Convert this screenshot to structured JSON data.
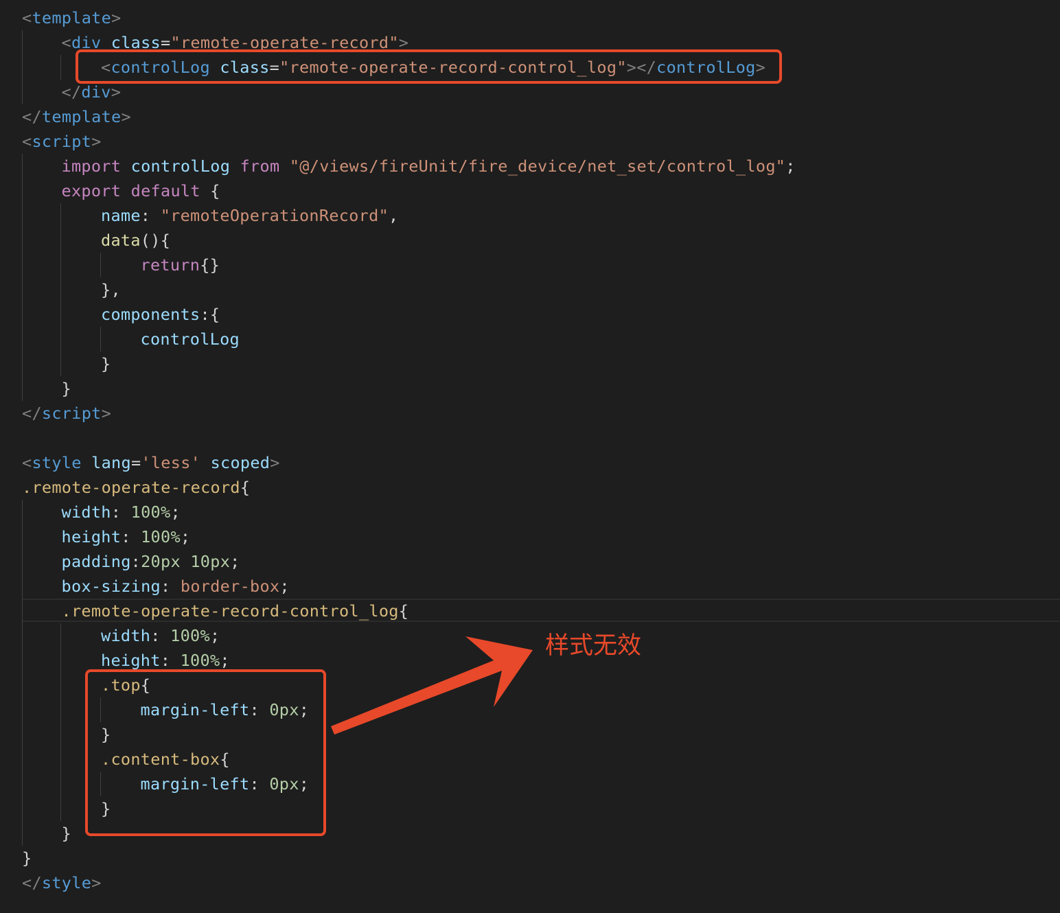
{
  "editor": {
    "colors": {
      "background": "#1e1e1e",
      "annotation": "#e8492a"
    },
    "lines": [
      [
        [
          "punc",
          "<"
        ],
        [
          "tag",
          "template"
        ],
        [
          "punc",
          ">"
        ]
      ],
      [
        [
          "punc",
          "<"
        ],
        [
          "tag",
          "div"
        ],
        [
          "text",
          " "
        ],
        [
          "attr",
          "class"
        ],
        [
          "text",
          "="
        ],
        [
          "str",
          "\"remote-operate-record\""
        ],
        [
          "punc",
          ">"
        ]
      ],
      [
        [
          "punc",
          "<"
        ],
        [
          "tag",
          "controlLog"
        ],
        [
          "text",
          " "
        ],
        [
          "attr",
          "class"
        ],
        [
          "text",
          "="
        ],
        [
          "str",
          "\"remote-operate-record-control_log\""
        ],
        [
          "punc",
          "></"
        ],
        [
          "tag",
          "controlLog"
        ],
        [
          "punc",
          ">"
        ]
      ],
      [
        [
          "punc",
          "</"
        ],
        [
          "tag",
          "div"
        ],
        [
          "punc",
          ">"
        ]
      ],
      [
        [
          "punc",
          "</"
        ],
        [
          "tag",
          "template"
        ],
        [
          "punc",
          ">"
        ]
      ],
      [
        [
          "punc",
          "<"
        ],
        [
          "tag",
          "script"
        ],
        [
          "punc",
          ">"
        ]
      ],
      [
        [
          "kw",
          "import"
        ],
        [
          "text",
          " "
        ],
        [
          "var",
          "controlLog"
        ],
        [
          "text",
          " "
        ],
        [
          "kw",
          "from"
        ],
        [
          "text",
          " "
        ],
        [
          "str",
          "\"@/views/fireUnit/fire_device/net_set/control_log\""
        ],
        [
          "text",
          ";"
        ]
      ],
      [
        [
          "kw",
          "export"
        ],
        [
          "text",
          " "
        ],
        [
          "kw",
          "default"
        ],
        [
          "text",
          " {"
        ]
      ],
      [
        [
          "var",
          "name"
        ],
        [
          "text",
          ": "
        ],
        [
          "str",
          "\"remoteOperationRecord\""
        ],
        [
          "text",
          ","
        ]
      ],
      [
        [
          "func",
          "data"
        ],
        [
          "text",
          "(){"
        ]
      ],
      [
        [
          "kw",
          "return"
        ],
        [
          "text",
          "{}"
        ]
      ],
      [
        [
          "text",
          "},"
        ]
      ],
      [
        [
          "var",
          "components"
        ],
        [
          "text",
          ":{"
        ]
      ],
      [
        [
          "var",
          "controlLog"
        ]
      ],
      [
        [
          "text",
          "}"
        ]
      ],
      [
        [
          "text",
          "}"
        ]
      ],
      [
        [
          "punc",
          "</"
        ],
        [
          "tag",
          "script"
        ],
        [
          "punc",
          ">"
        ]
      ],
      [],
      [
        [
          "punc",
          "<"
        ],
        [
          "tag",
          "style"
        ],
        [
          "text",
          " "
        ],
        [
          "attr",
          "lang"
        ],
        [
          "text",
          "="
        ],
        [
          "str",
          "'less'"
        ],
        [
          "text",
          " "
        ],
        [
          "attr",
          "scoped"
        ],
        [
          "punc",
          ">"
        ]
      ],
      [
        [
          "sel",
          ".remote-operate-record"
        ],
        [
          "text",
          "{"
        ]
      ],
      [
        [
          "prop",
          "width"
        ],
        [
          "text",
          ": "
        ],
        [
          "num",
          "100%"
        ],
        [
          "text",
          ";"
        ]
      ],
      [
        [
          "prop",
          "height"
        ],
        [
          "text",
          ": "
        ],
        [
          "num",
          "100%"
        ],
        [
          "text",
          ";"
        ]
      ],
      [
        [
          "prop",
          "padding"
        ],
        [
          "text",
          ":"
        ],
        [
          "num",
          "20px"
        ],
        [
          "text",
          " "
        ],
        [
          "num",
          "10px"
        ],
        [
          "text",
          ";"
        ]
      ],
      [
        [
          "prop",
          "box-sizing"
        ],
        [
          "text",
          ": "
        ],
        [
          "val",
          "border-box"
        ],
        [
          "text",
          ";"
        ]
      ],
      [
        [
          "sel",
          ".remote-operate-record-control_log"
        ],
        [
          "text",
          "{"
        ]
      ],
      [
        [
          "prop",
          "width"
        ],
        [
          "text",
          ": "
        ],
        [
          "num",
          "100%"
        ],
        [
          "text",
          ";"
        ]
      ],
      [
        [
          "prop",
          "height"
        ],
        [
          "text",
          ": "
        ],
        [
          "num",
          "100%"
        ],
        [
          "text",
          ";"
        ]
      ],
      [
        [
          "sel",
          ".top"
        ],
        [
          "text",
          "{"
        ]
      ],
      [
        [
          "prop",
          "margin-left"
        ],
        [
          "text",
          ": "
        ],
        [
          "num",
          "0px"
        ],
        [
          "text",
          ";"
        ]
      ],
      [
        [
          "text",
          "}"
        ]
      ],
      [
        [
          "sel",
          ".content-box"
        ],
        [
          "text",
          "{"
        ]
      ],
      [
        [
          "prop",
          "margin-left"
        ],
        [
          "text",
          ": "
        ],
        [
          "num",
          "0px"
        ],
        [
          "text",
          ";"
        ]
      ],
      [
        [
          "text",
          "}"
        ]
      ],
      [
        [
          "text",
          "}"
        ]
      ],
      [
        [
          "text",
          "}"
        ]
      ],
      [
        [
          "punc",
          "</"
        ],
        [
          "tag",
          "style"
        ],
        [
          "punc",
          ">"
        ]
      ]
    ]
  },
  "annotation": {
    "label": "样式无效"
  }
}
